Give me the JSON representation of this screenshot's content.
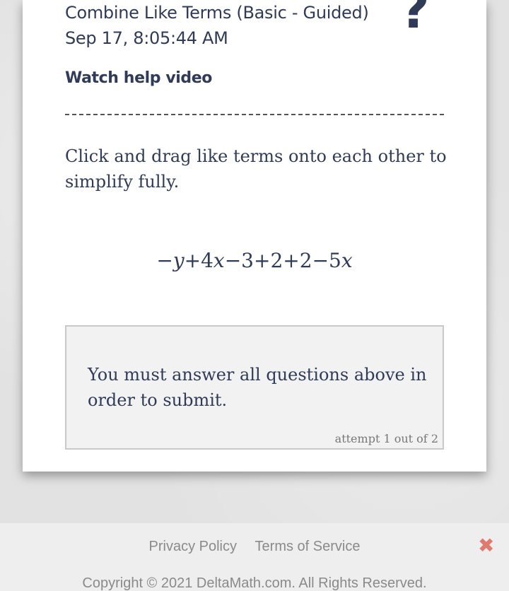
{
  "assignment": {
    "title": "Combine Like Terms (Basic - Guided)",
    "timestamp": "Sep 17, 8:05:44 AM",
    "help_icon_glyph": "?",
    "help_link": "Watch help video"
  },
  "problem": {
    "instructions": "Click and drag like terms onto each other to simplify fully.",
    "terms": [
      "−y",
      "+4x",
      "−3",
      "+2",
      "+2",
      "−5x"
    ]
  },
  "submit": {
    "message": "You must answer all questions above in order to submit.",
    "attempt": "attempt 1 out of 2"
  },
  "footer": {
    "privacy": "Privacy Policy",
    "terms": "Terms of Service",
    "close_glyph": "✖",
    "copyright": "Copyright © 2021 DeltaMath.com. All Rights Reserved."
  },
  "colors": {
    "text": "#2f3b57",
    "close": "#e07a6e",
    "footer_text": "#8a8a8a"
  }
}
